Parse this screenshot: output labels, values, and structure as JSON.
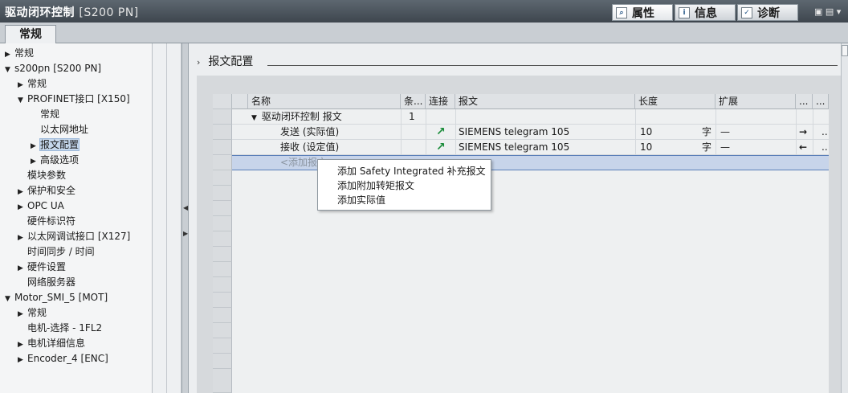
{
  "title": {
    "main": "驱动闭环控制",
    "sub": "[S200 PN]"
  },
  "top_tabs": [
    {
      "label": "属性",
      "icon": "properties-icon",
      "active": true
    },
    {
      "label": "信息",
      "icon": "info-icon",
      "active": false
    },
    {
      "label": "诊断",
      "icon": "diagnostics-icon",
      "active": false
    }
  ],
  "window_controls": {
    "icons": "▣ ▤ ▾"
  },
  "tab": {
    "label": "常规"
  },
  "nav": [
    {
      "label": "常规",
      "expander": "▶"
    },
    {
      "label": "s200pn [S200 PN]",
      "expander": "▼"
    },
    {
      "label": "常规",
      "expander": "▶"
    },
    {
      "label": "PROFINET接口 [X150]",
      "expander": "▼"
    },
    {
      "label": "常规",
      "expander": ""
    },
    {
      "label": "以太网地址",
      "expander": ""
    },
    {
      "label": "报文配置",
      "expander": "▶",
      "selected": true
    },
    {
      "label": "高级选项",
      "expander": "▶"
    },
    {
      "label": "模块参数",
      "expander": ""
    },
    {
      "label": "保护和安全",
      "expander": "▶"
    },
    {
      "label": "OPC UA",
      "expander": "▶"
    },
    {
      "label": "硬件标识符",
      "expander": ""
    },
    {
      "label": "以太网调试接口 [X127]",
      "expander": "▶"
    },
    {
      "label": "时间同步 / 时间",
      "expander": ""
    },
    {
      "label": "硬件设置",
      "expander": "▶"
    },
    {
      "label": "网络服务器",
      "expander": ""
    },
    {
      "label": "Motor_SMI_5 [MOT]",
      "expander": "▼"
    },
    {
      "label": "常规",
      "expander": "▶"
    },
    {
      "label": "电机-选择 - 1FL2",
      "expander": ""
    },
    {
      "label": "电机详细信息",
      "expander": "▶"
    },
    {
      "label": "Encoder_4 [ENC]",
      "expander": "▶"
    }
  ],
  "section": {
    "title": "报文配置",
    "chevron": "›"
  },
  "table": {
    "headers": [
      "名称",
      "条...",
      "连接",
      "报文",
      "长度",
      "扩展",
      "...",
      "..."
    ],
    "rows": [
      {
        "expander": "▼",
        "name": "驱动闭环控制 报文",
        "count": "1",
        "conn": "",
        "telegram": "",
        "length": "",
        "unit": "",
        "ext": "",
        "arrow": "",
        "more": ""
      },
      {
        "expander": "",
        "name": "发送 (实际值)",
        "count": "",
        "conn": "↗",
        "telegram": "SIEMENS telegram 105",
        "length": "10",
        "unit": "字",
        "ext": "—",
        "arrow": "→",
        "more": ".."
      },
      {
        "expander": "",
        "name": "接收 (设定值)",
        "count": "",
        "conn": "↗",
        "telegram": "SIEMENS telegram 105",
        "length": "10",
        "unit": "字",
        "ext": "—",
        "arrow": "←",
        "more": ".."
      }
    ],
    "add_row": {
      "placeholder": "<添加报文>"
    }
  },
  "context_menu": [
    "添加 Safety Integrated 补充报文",
    "添加附加转矩报文",
    "添加实际值"
  ]
}
